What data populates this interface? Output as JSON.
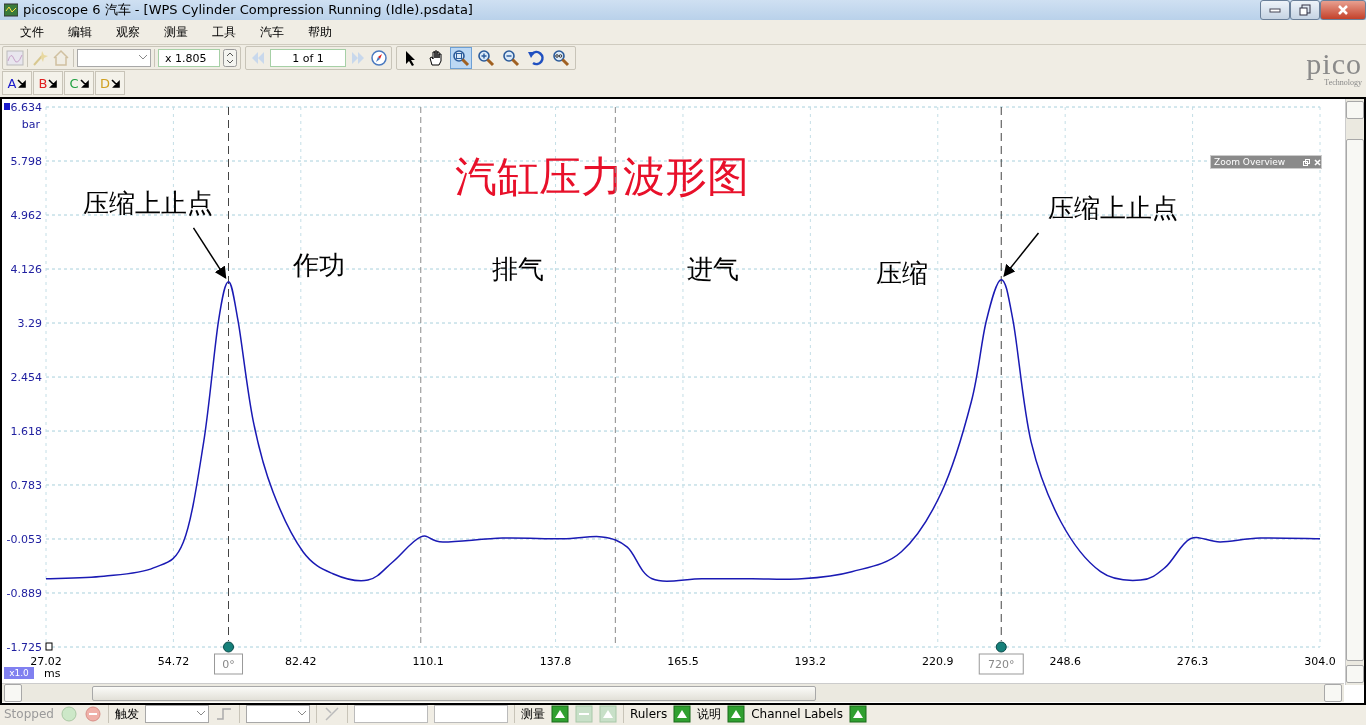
{
  "window": {
    "title": "picoscope 6 汽车 - [WPS Cylinder Compression Running (Idle).psdata]"
  },
  "menu": [
    "文件",
    "编辑",
    "观察",
    "测量",
    "工具",
    "汽车",
    "帮助"
  ],
  "toolbar": {
    "scale": "x 1.805",
    "page": "1 of 1",
    "tools": [
      {
        "kind": "pointer",
        "selected": false
      },
      {
        "kind": "hand",
        "selected": false
      },
      {
        "kind": "zoom-box",
        "selected": true
      },
      {
        "kind": "zoom-in",
        "selected": false
      },
      {
        "kind": "zoom-out",
        "selected": false
      },
      {
        "kind": "undo",
        "selected": false
      },
      {
        "kind": "zoom-fit",
        "selected": false
      }
    ]
  },
  "logo": {
    "text": "pico",
    "subtitle": "Technology"
  },
  "channels": [
    {
      "label": "A",
      "color": "#1a1acc"
    },
    {
      "label": "B",
      "color": "#e02020"
    },
    {
      "label": "C",
      "color": "#20a040"
    },
    {
      "label": "D",
      "color": "#d0a020"
    }
  ],
  "chart": {
    "cursor_labels": [
      "0°",
      "720°"
    ],
    "unit": "bar",
    "time_unit": "ms",
    "scale_badge": "x1.0",
    "zoom_overview": {
      "title": "Zoom Overview"
    },
    "chart_data": {
      "type": "line",
      "title": "汽缸压力波形图",
      "grid": true,
      "xlim": [
        27.02,
        304.0
      ],
      "ylim": [
        -1.725,
        6.634
      ],
      "xticks": [
        {
          "value": 27.02,
          "label": "27.02"
        },
        {
          "value": 54.72,
          "label": "54.72"
        },
        {
          "value": 82.42,
          "label": "82.42"
        },
        {
          "value": 110.1,
          "label": "110.1"
        },
        {
          "value": 137.8,
          "label": "137.8"
        },
        {
          "value": 165.5,
          "label": "165.5"
        },
        {
          "value": 193.2,
          "label": "193.2"
        },
        {
          "value": 220.9,
          "label": "220.9"
        },
        {
          "value": 248.6,
          "label": "248.6"
        },
        {
          "value": 276.3,
          "label": "276.3"
        },
        {
          "value": 304.0,
          "label": "304.0"
        }
      ],
      "yticks": [
        {
          "value": 6.634,
          "label": "6.634"
        },
        {
          "value": 5.798,
          "label": "5.798"
        },
        {
          "value": 4.962,
          "label": "4.962"
        },
        {
          "value": 4.126,
          "label": "4.126"
        },
        {
          "value": 3.29,
          "label": "3.29"
        },
        {
          "value": 2.454,
          "label": "2.454"
        },
        {
          "value": 1.618,
          "label": "1.618"
        },
        {
          "value": 0.783,
          "label": "0.783"
        },
        {
          "value": -0.053,
          "label": "-0.053"
        },
        {
          "value": -0.889,
          "label": "-0.889"
        },
        {
          "value": -1.725,
          "label": "-1.725"
        }
      ],
      "x": [
        27.02,
        39.6,
        50.4,
        56.9,
        61.3,
        64.5,
        66.7,
        68.8,
        72.1,
        76.4,
        82.9,
        89.4,
        97.0,
        102.4,
        108.5,
        113.3,
        126.3,
        139.3,
        147.9,
        153.4,
        158.8,
        169.6,
        180.5,
        191.3,
        202.2,
        213.0,
        221.7,
        228.2,
        231.4,
        234.7,
        237.3,
        241.2,
        247.7,
        256.3,
        265.0,
        270.4,
        275.8,
        282.3,
        291.0,
        304.0
      ],
      "series": [
        {
          "color": "#1a1ab4",
          "values": [
            -0.67,
            -0.63,
            -0.5,
            -0.1,
            1.45,
            3.31,
            3.93,
            3.31,
            1.76,
            0.67,
            -0.25,
            -0.59,
            -0.69,
            -0.41,
            -0.02,
            -0.1,
            -0.04,
            -0.05,
            -0.02,
            -0.18,
            -0.67,
            -0.67,
            -0.67,
            -0.67,
            -0.56,
            -0.25,
            0.67,
            2.07,
            3.31,
            3.96,
            3.31,
            1.45,
            0.21,
            -0.56,
            -0.69,
            -0.49,
            -0.05,
            -0.1,
            -0.04,
            -0.05
          ]
        }
      ],
      "ref_lines": [
        {
          "axis": "x",
          "value": 66.7,
          "color": "#444444"
        },
        {
          "axis": "x",
          "value": 234.7,
          "color": "#444444"
        },
        {
          "axis": "x",
          "value": 108.5,
          "color": "#8a8a8a"
        },
        {
          "axis": "x",
          "value": 150.8,
          "color": "#8a8a8a"
        }
      ],
      "annotations": [
        "压缩上止点",
        "作功",
        "排气",
        "进气",
        "压缩",
        "压缩上止点"
      ]
    }
  },
  "status_bar": {
    "state": "Stopped",
    "trigger": "触发",
    "measurements": "测量",
    "rulers": "Rulers",
    "notes": "说明",
    "channel_labels": "Channel Labels"
  }
}
